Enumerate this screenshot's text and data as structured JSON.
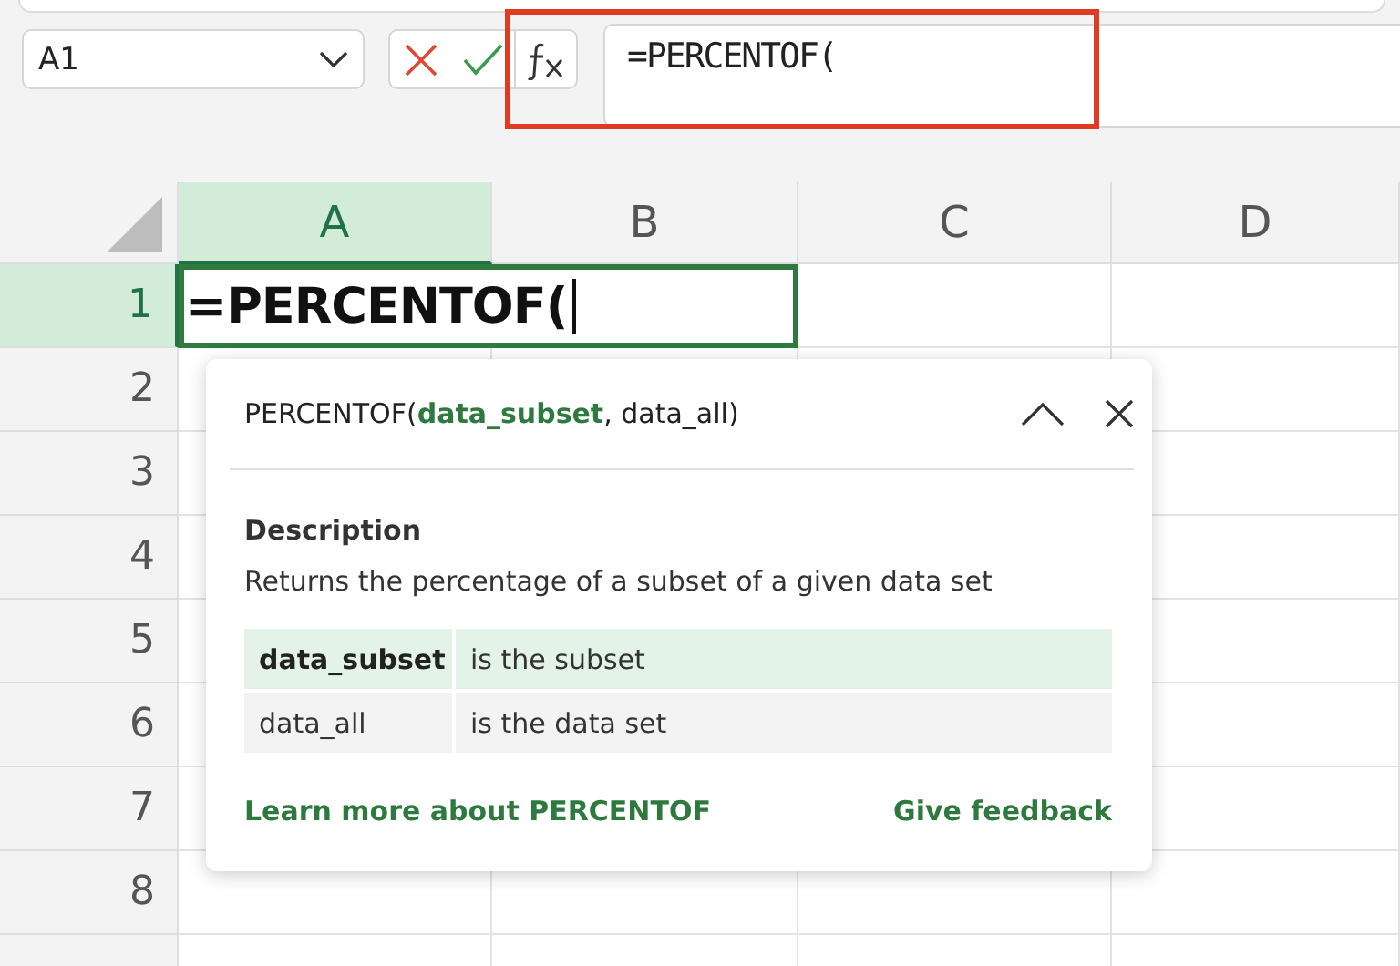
{
  "name_box": {
    "value": "A1"
  },
  "formula_bar": {
    "value": "=PERCENTOF("
  },
  "columns": [
    {
      "label": "A",
      "selected": true
    },
    {
      "label": "B",
      "selected": false
    },
    {
      "label": "C",
      "selected": false
    },
    {
      "label": "D",
      "selected": false
    }
  ],
  "rows": [
    {
      "label": "1",
      "selected": true
    },
    {
      "label": "2",
      "selected": false
    },
    {
      "label": "3",
      "selected": false
    },
    {
      "label": "4",
      "selected": false
    },
    {
      "label": "5",
      "selected": false
    },
    {
      "label": "6",
      "selected": false
    },
    {
      "label": "7",
      "selected": false
    },
    {
      "label": "8",
      "selected": false
    }
  ],
  "cell_editor": {
    "value": "=PERCENTOF("
  },
  "tooltip": {
    "signature": {
      "name": "PERCENTOF(",
      "args": [
        {
          "text": "data_subset",
          "selected": true
        },
        {
          "text": ", data_all)",
          "selected": false
        }
      ]
    },
    "description_heading": "Description",
    "description": "Returns the percentage of a subset of a given data set",
    "parameters": [
      {
        "name": "data_subset",
        "text": "is the subset",
        "selected": true
      },
      {
        "name": "data_all",
        "text": "is the data set",
        "selected": false
      }
    ],
    "learn_more": "Learn more about PERCENTOF",
    "feedback": "Give feedback"
  }
}
